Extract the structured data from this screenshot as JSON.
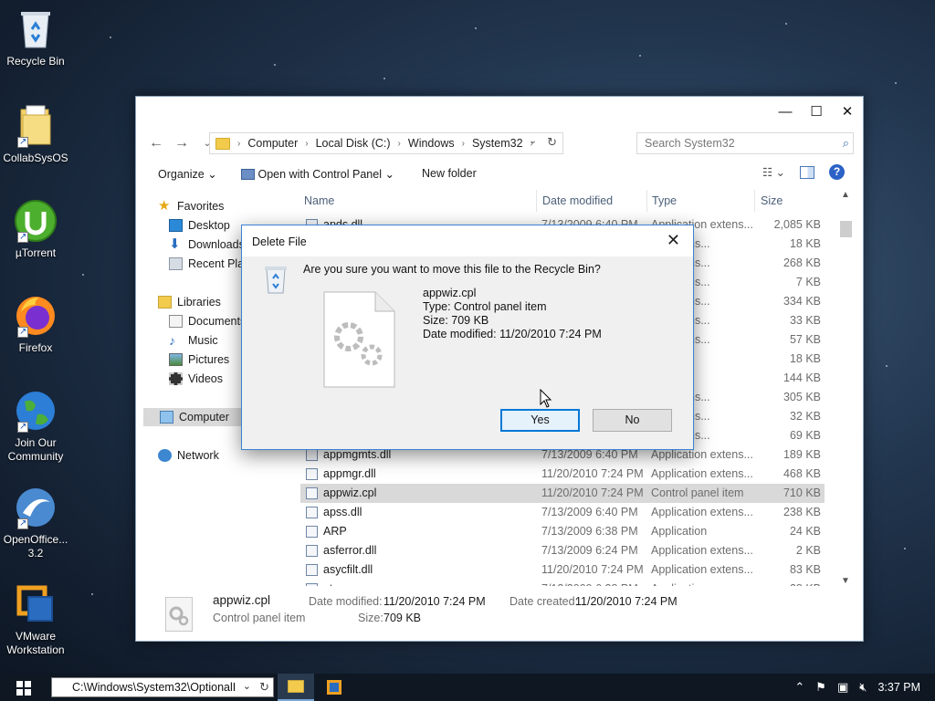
{
  "desktop": {
    "icons": [
      {
        "label": "Recycle Bin"
      },
      {
        "label": "CollabSysOS"
      },
      {
        "label": "µTorrent"
      },
      {
        "label": "Firefox"
      },
      {
        "label": "Join Our Community"
      },
      {
        "label": "OpenOffice... 3.2"
      },
      {
        "label": "VMware Workstation"
      }
    ]
  },
  "explorer": {
    "breadcrumb": [
      "Computer",
      "Local Disk (C:)",
      "Windows",
      "System32"
    ],
    "search_placeholder": "Search System32",
    "toolbar": {
      "organize": "Organize",
      "open_with": "Open with Control Panel",
      "new_folder": "New folder"
    },
    "nav": {
      "favorites": "Favorites",
      "desktop": "Desktop",
      "downloads": "Downloads",
      "recent": "Recent Plac",
      "libraries": "Libraries",
      "documents": "Documents",
      "music": "Music",
      "pictures": "Pictures",
      "videos": "Videos",
      "computer": "Computer",
      "network": "Network"
    },
    "columns": {
      "name": "Name",
      "date": "Date modified",
      "type": "Type",
      "size": "Size"
    },
    "rows": [
      {
        "name": "apds.dll",
        "date": "7/13/2009 6:40 PM",
        "type": "Application extens...",
        "size": "2,085 KB"
      },
      {
        "name": "",
        "date": "",
        "type": "on extens...",
        "size": "18 KB"
      },
      {
        "name": "",
        "date": "",
        "type": "on extens...",
        "size": "268 KB"
      },
      {
        "name": "",
        "date": "",
        "type": "on extens...",
        "size": "7 KB"
      },
      {
        "name": "",
        "date": "",
        "type": "on extens...",
        "size": "334 KB"
      },
      {
        "name": "",
        "date": "",
        "type": "on extens...",
        "size": "33 KB"
      },
      {
        "name": "",
        "date": "",
        "type": "on extens...",
        "size": "57 KB"
      },
      {
        "name": "",
        "date": "",
        "type": "on",
        "size": "18 KB"
      },
      {
        "name": "",
        "date": "",
        "type": "on",
        "size": "144 KB"
      },
      {
        "name": "",
        "date": "",
        "type": "on extens...",
        "size": "305 KB"
      },
      {
        "name": "",
        "date": "",
        "type": "on extens...",
        "size": "32 KB"
      },
      {
        "name": "",
        "date": "",
        "type": "on extens...",
        "size": "69 KB"
      },
      {
        "name": "appmgmts.dll",
        "date": "7/13/2009 6:40 PM",
        "type": "Application extens...",
        "size": "189 KB"
      },
      {
        "name": "appmgr.dll",
        "date": "11/20/2010 7:24 PM",
        "type": "Application extens...",
        "size": "468 KB"
      },
      {
        "name": "appwiz.cpl",
        "date": "11/20/2010 7:24 PM",
        "type": "Control panel item",
        "size": "710 KB"
      },
      {
        "name": "apss.dll",
        "date": "7/13/2009 6:40 PM",
        "type": "Application extens...",
        "size": "238 KB"
      },
      {
        "name": "ARP",
        "date": "7/13/2009 6:38 PM",
        "type": "Application",
        "size": "24 KB"
      },
      {
        "name": "asferror.dll",
        "date": "7/13/2009 6:24 PM",
        "type": "Application extens...",
        "size": "2 KB"
      },
      {
        "name": "asycfilt.dll",
        "date": "11/20/2010 7:24 PM",
        "type": "Application extens...",
        "size": "83 KB"
      },
      {
        "name": "at",
        "date": "7/13/2009 6:38 PM",
        "type": "Application",
        "size": "28 KB"
      }
    ],
    "details": {
      "name": "appwiz.cpl",
      "type": "Control panel item",
      "date_modified_label": "Date modified:",
      "date_modified": "11/20/2010 7:24 PM",
      "date_created_label": "Date created:",
      "date_created": "11/20/2010 7:24 PM",
      "size_label": "Size:",
      "size": "709 KB"
    }
  },
  "dialog": {
    "title": "Delete File",
    "question": "Are you sure you want to move this file to the Recycle Bin?",
    "file_name": "appwiz.cpl",
    "file_type": "Type: Control panel item",
    "file_size": "Size: 709 KB",
    "file_date": "Date modified: 11/20/2010 7:24 PM",
    "yes": "Yes",
    "no": "No"
  },
  "taskbar": {
    "address": "C:\\Windows\\System32\\OptionalI",
    "clock": "3:37 PM"
  }
}
